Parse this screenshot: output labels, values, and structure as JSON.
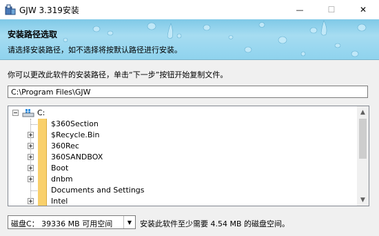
{
  "window": {
    "title": "GJW 3.319安装",
    "controls": {
      "minimize": "—",
      "maximize": "☐",
      "close": "✕"
    }
  },
  "header": {
    "title": "安装路径选取",
    "subtitle": "请选择安装路径，如不选择将按默认路径进行安装。"
  },
  "instruction": "你可以更改此软件的安装路径，单击“下一步”按钮开始复制文件。",
  "path_input": {
    "value": "C:\\Program Files\\GJW"
  },
  "tree": {
    "root": {
      "label": "C:",
      "icon": "drive-icon",
      "expanded": true
    },
    "items": [
      {
        "label": "$360Section",
        "expandable": false
      },
      {
        "label": "$Recycle.Bin",
        "expandable": true
      },
      {
        "label": "360Rec",
        "expandable": true
      },
      {
        "label": "360SANDBOX",
        "expandable": true
      },
      {
        "label": "Boot",
        "expandable": true
      },
      {
        "label": "dnbm",
        "expandable": true
      },
      {
        "label": "Documents and Settings",
        "expandable": false
      },
      {
        "label": "Intel",
        "expandable": true
      }
    ]
  },
  "drive_select": {
    "value": "磁盘C： 39336 MB 可用空间"
  },
  "space_info": "安装此软件至少需要 4.54 MB 的磁盘空间。",
  "colors": {
    "header_top": "#7fc9e7",
    "header_bottom": "#8fd3ee",
    "folder": "#f9d06b"
  }
}
